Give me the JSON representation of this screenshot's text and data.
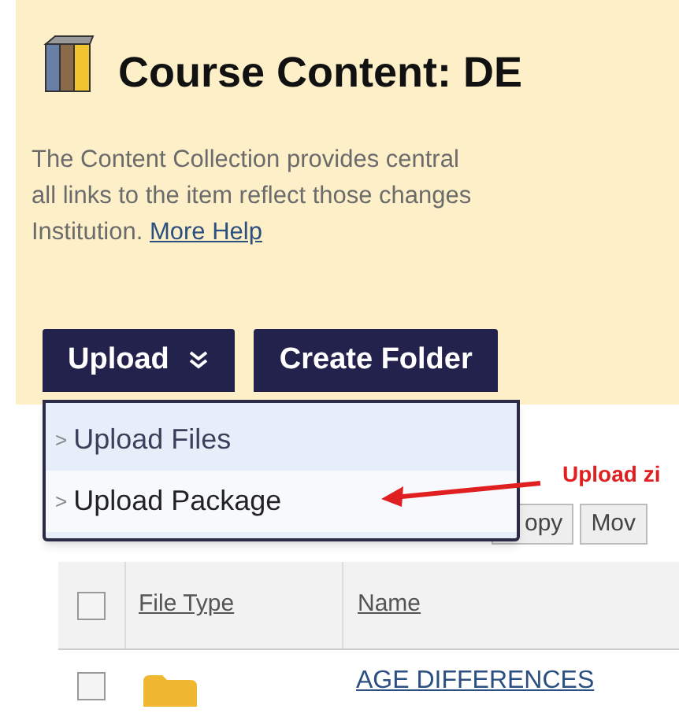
{
  "header": {
    "title": "Course Content: DE",
    "description": [
      "The Content Collection provides central",
      "all links to the item reflect those changes",
      "Institution."
    ],
    "help_link": "More Help"
  },
  "action_bar": {
    "buttons": [
      {
        "label": "Upload",
        "kind": "menu"
      },
      {
        "label": "Create Folder",
        "kind": "plain"
      }
    ]
  },
  "upload_menu": {
    "items": [
      {
        "marker": ">",
        "label": "Upload Files",
        "selected": false
      },
      {
        "marker": ">",
        "label": "Upload Package",
        "selected": true
      }
    ]
  },
  "annotation": {
    "text": "Upload zi"
  },
  "toolbar": {
    "buttons": [
      "opy",
      "Mov"
    ]
  },
  "table": {
    "select_all": {
      "checked": false
    },
    "columns": [
      "File Type",
      "Name"
    ],
    "rows": [
      {
        "checked": false,
        "kind": "folder",
        "name": "AGE DIFFERENCES"
      }
    ]
  }
}
